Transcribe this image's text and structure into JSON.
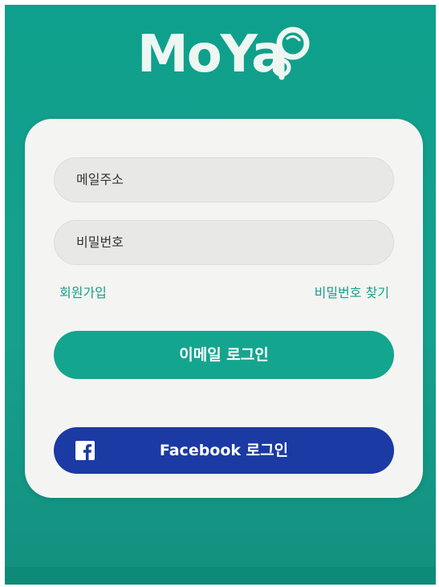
{
  "app": {
    "logo_text": "MoYa",
    "logo_mark_icon": "magnifier-question-mark-icon"
  },
  "login": {
    "email_placeholder": "메일주소",
    "password_placeholder": "비밀번호",
    "signup_link": "회원가입",
    "find_password_link": "비밀번호 찾기",
    "email_login_button": "이메일 로그인",
    "facebook_login_button": "Facebook 로그인",
    "facebook_icon": "facebook-icon"
  },
  "colors": {
    "background": "#16a18e",
    "card": "#f4f4f2",
    "email_button": "#14a58f",
    "facebook_button": "#1b3aa3",
    "link_text": "#1a9d88"
  }
}
